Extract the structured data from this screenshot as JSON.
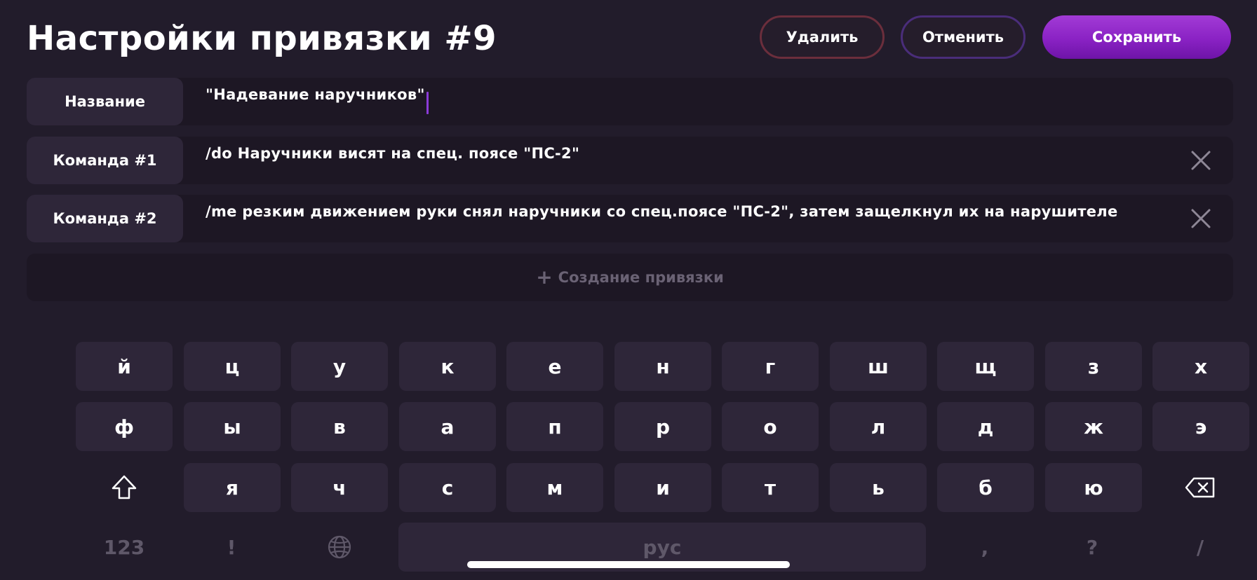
{
  "header": {
    "title": "Настройки привязки #9",
    "delete_label": "Удалить",
    "cancel_label": "Отменить",
    "save_label": "Сохранить"
  },
  "fields": {
    "name": {
      "label": "Название",
      "value": "\"Надевание наручников\""
    },
    "commands": [
      {
        "label": "Команда #1",
        "value": "/do Наручники висят на спец. поясе \"ПС-2\""
      },
      {
        "label": "Команда #2",
        "value": "/me резким движением руки снял наручники со спец.поясе \"ПС-2\", затем защелкнул их на нарушителе"
      }
    ],
    "add_label": "Создание привязки",
    "add_icon": "plus-icon",
    "remove_icon": "close-icon"
  },
  "keyboard": {
    "row1": [
      "й",
      "ц",
      "у",
      "к",
      "е",
      "н",
      "г",
      "ш",
      "щ",
      "з",
      "х"
    ],
    "row2": [
      "ф",
      "ы",
      "в",
      "а",
      "п",
      "р",
      "о",
      "л",
      "д",
      "ж",
      "э"
    ],
    "row3": [
      "я",
      "ч",
      "с",
      "м",
      "и",
      "т",
      "ь",
      "б",
      "ю"
    ],
    "shift_icon": "shift-icon",
    "backspace_icon": "backspace-icon",
    "numbers_label": "123",
    "exclaim_label": "!",
    "globe_icon": "globe-icon",
    "space_label": "рус",
    "comma_label": ",",
    "question_label": "?",
    "slash_label": "/"
  },
  "colors": {
    "background": "#221c2b",
    "field_label_bg": "#2e2639",
    "field_bg": "#1d1724",
    "accent": "#9a30d4",
    "delete_border": "#6b2e3c",
    "cancel_border": "#4a2d7a",
    "caret": "#8b3bd8"
  }
}
